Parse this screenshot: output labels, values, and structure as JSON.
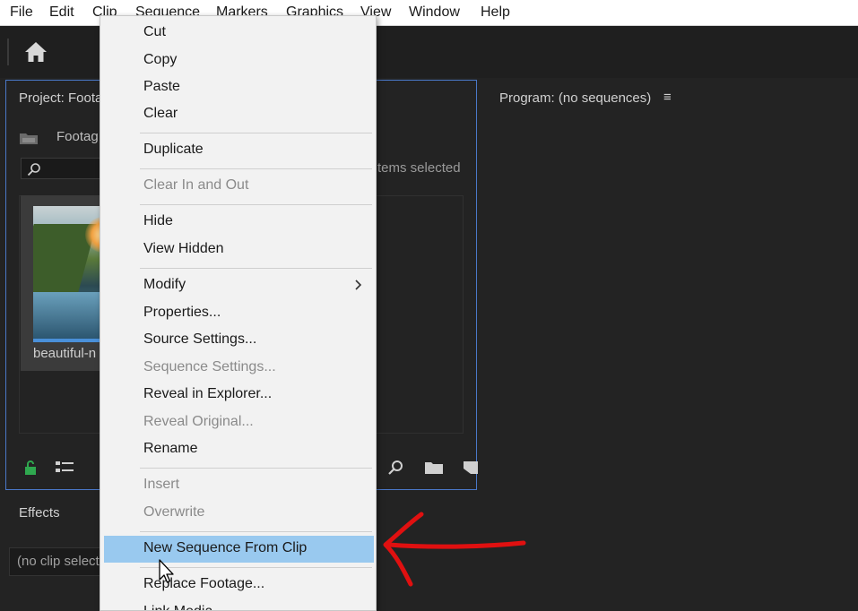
{
  "menubar": {
    "items": [
      "File",
      "Edit",
      "Clip",
      "Sequence",
      "Markers",
      "Graphics",
      "View",
      "Window",
      "Help"
    ]
  },
  "header": {
    "home_icon": "home-icon"
  },
  "project_panel": {
    "title": "Project: Foota",
    "bin_name": "Footag",
    "search_placeholder": "",
    "items_selected": "tems selected",
    "clip_label": "beautiful-n"
  },
  "program_panel": {
    "title": "Program: (no sequences)",
    "menu_glyph": "≡"
  },
  "effects_panel": {
    "title": "Effects",
    "field_text": "(no clip select"
  },
  "context_menu": {
    "items": [
      {
        "label": "Cut"
      },
      {
        "label": "Copy"
      },
      {
        "label": "Paste"
      },
      {
        "label": "Clear"
      },
      {
        "label": "Duplicate"
      },
      {
        "label": "Clear In and Out"
      },
      {
        "label": "Hide"
      },
      {
        "label": "View Hidden"
      },
      {
        "label": "Modify"
      },
      {
        "label": "Properties..."
      },
      {
        "label": "Source Settings..."
      },
      {
        "label": "Sequence Settings..."
      },
      {
        "label": "Reveal in Explorer..."
      },
      {
        "label": "Reveal Original..."
      },
      {
        "label": "Rename"
      },
      {
        "label": "Insert"
      },
      {
        "label": "Overwrite"
      },
      {
        "label": "New Sequence From Clip"
      },
      {
        "label": "Replace Footage..."
      },
      {
        "label": "Link Media..."
      }
    ]
  },
  "colors": {
    "accent_border": "#4a78c8",
    "highlight": "#99c9ef",
    "annotation_arrow": "#e01010",
    "lock_green": "#2fa84f"
  }
}
